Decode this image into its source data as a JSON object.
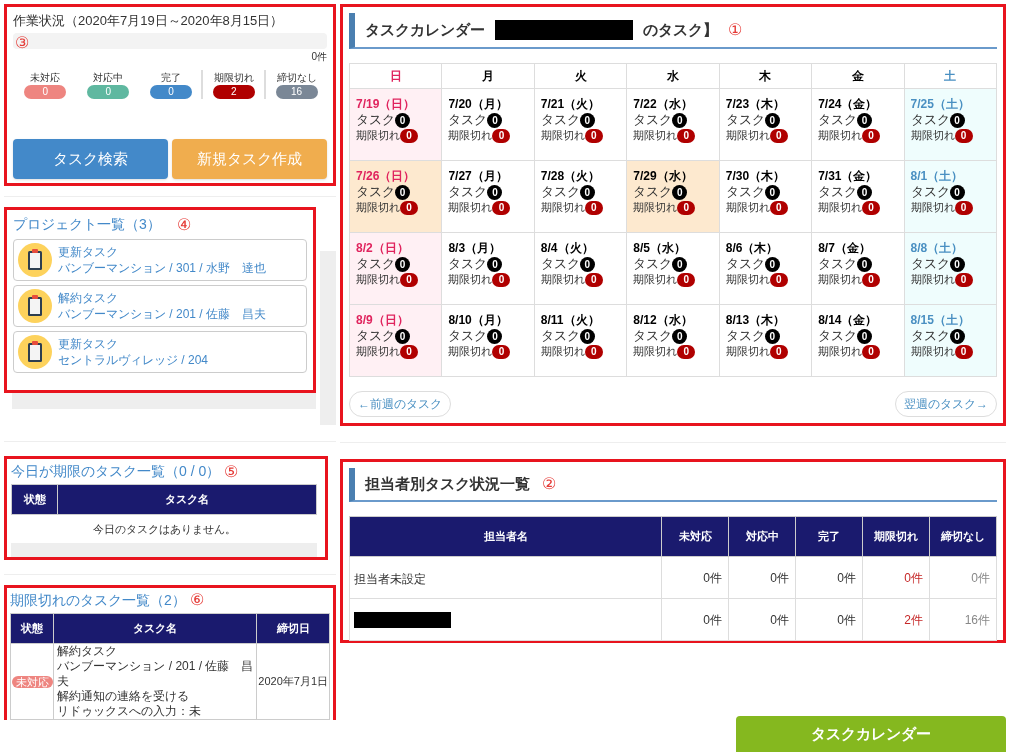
{
  "work_status": {
    "title": "作業状況（2020年7月19日～2020年8月15日）",
    "marker": "③",
    "progress": {
      "level": 0,
      "count": "0件"
    },
    "statuses": [
      {
        "label": "未対応",
        "count": "0",
        "color": "#ee8580",
        "separated": false
      },
      {
        "label": "対応中",
        "count": "0",
        "color": "#5fb8a0",
        "separated": false
      },
      {
        "label": "完了",
        "count": "0",
        "color": "#4389c9",
        "separated": false
      },
      {
        "label": "期限切れ",
        "count": "2",
        "color": "#b00000",
        "separated": true
      },
      {
        "label": "締切なし",
        "count": "16",
        "color": "#7a8796",
        "separated": true
      }
    ],
    "buttons": [
      {
        "label": "タスク検索",
        "kind": "primary"
      },
      {
        "label": "新規タスク作成",
        "kind": "warning"
      }
    ]
  },
  "projects": {
    "title": "プロジェクト一覧（3）",
    "marker": "④",
    "items": [
      {
        "title": "更新タスク",
        "detail": "バンブーマンション / 301 / 水野　達也"
      },
      {
        "title": "解約タスク",
        "detail": "バンブーマンション / 201 / 佐藤　昌夫"
      },
      {
        "title": "更新タスク",
        "detail": "セントラルヴィレッジ / 204"
      }
    ]
  },
  "today_tasks": {
    "title": "今日が期限のタスク一覧（0 / 0）",
    "marker": "⑤",
    "columns": [
      "状態",
      "タスク名"
    ],
    "empty_message": "今日のタスクはありません。"
  },
  "overdue_tasks": {
    "title": "期限切れのタスク一覧（2）",
    "marker": "⑥",
    "columns": [
      "状態",
      "タスク名",
      "締切日"
    ],
    "rows": [
      {
        "status": "未対応",
        "lines": [
          "解約タスク",
          "バンブーマンション / 201 / 佐藤　昌",
          "夫",
          "解約通知の連絡を受ける",
          "リドゥックスへの入力：未"
        ],
        "deadline": "2020年7月1日"
      }
    ]
  },
  "calendar": {
    "title": "タスクカレンダー",
    "suffix": "のタスク】",
    "marker": "①",
    "weekdays": [
      {
        "label": "日",
        "kind": "sun"
      },
      {
        "label": "月",
        "kind": "weekday"
      },
      {
        "label": "火",
        "kind": "weekday"
      },
      {
        "label": "水",
        "kind": "weekday"
      },
      {
        "label": "木",
        "kind": "weekday"
      },
      {
        "label": "金",
        "kind": "weekday"
      },
      {
        "label": "土",
        "kind": "sat"
      }
    ],
    "weeks": [
      [
        {
          "date": "7/19（日）",
          "kind": "sun",
          "highlight": false,
          "task_label": "タスク",
          "tasks": "0",
          "overdue_label": "期限切れ",
          "overdue": "0"
        },
        {
          "date": "7/20（月）",
          "kind": "weekday",
          "highlight": false,
          "task_label": "タスク",
          "tasks": "0",
          "overdue_label": "期限切れ",
          "overdue": "0"
        },
        {
          "date": "7/21（火）",
          "kind": "weekday",
          "highlight": false,
          "task_label": "タスク",
          "tasks": "0",
          "overdue_label": "期限切れ",
          "overdue": "0"
        },
        {
          "date": "7/22（水）",
          "kind": "weekday",
          "highlight": false,
          "task_label": "タスク",
          "tasks": "0",
          "overdue_label": "期限切れ",
          "overdue": "0"
        },
        {
          "date": "7/23（木）",
          "kind": "weekday",
          "highlight": false,
          "task_label": "タスク",
          "tasks": "0",
          "overdue_label": "期限切れ",
          "overdue": "0"
        },
        {
          "date": "7/24（金）",
          "kind": "weekday",
          "highlight": false,
          "task_label": "タスク",
          "tasks": "0",
          "overdue_label": "期限切れ",
          "overdue": "0"
        },
        {
          "date": "7/25（土）",
          "kind": "sat",
          "highlight": false,
          "task_label": "タスク",
          "tasks": "0",
          "overdue_label": "期限切れ",
          "overdue": "0"
        }
      ],
      [
        {
          "date": "7/26（日）",
          "kind": "sun",
          "highlight": true,
          "task_label": "タスク",
          "tasks": "0",
          "overdue_label": "期限切れ",
          "overdue": "0"
        },
        {
          "date": "7/27（月）",
          "kind": "weekday",
          "highlight": false,
          "task_label": "タスク",
          "tasks": "0",
          "overdue_label": "期限切れ",
          "overdue": "0"
        },
        {
          "date": "7/28（火）",
          "kind": "weekday",
          "highlight": false,
          "task_label": "タスク",
          "tasks": "0",
          "overdue_label": "期限切れ",
          "overdue": "0"
        },
        {
          "date": "7/29（水）",
          "kind": "weekday",
          "highlight": true,
          "task_label": "タスク",
          "tasks": "0",
          "overdue_label": "期限切れ",
          "overdue": "0"
        },
        {
          "date": "7/30（木）",
          "kind": "weekday",
          "highlight": false,
          "task_label": "タスク",
          "tasks": "0",
          "overdue_label": "期限切れ",
          "overdue": "0"
        },
        {
          "date": "7/31（金）",
          "kind": "weekday",
          "highlight": false,
          "task_label": "タスク",
          "tasks": "0",
          "overdue_label": "期限切れ",
          "overdue": "0"
        },
        {
          "date": "8/1（土）",
          "kind": "sat",
          "highlight": false,
          "task_label": "タスク",
          "tasks": "0",
          "overdue_label": "期限切れ",
          "overdue": "0"
        }
      ],
      [
        {
          "date": "8/2（日）",
          "kind": "sun",
          "highlight": false,
          "task_label": "タスク",
          "tasks": "0",
          "overdue_label": "期限切れ",
          "overdue": "0"
        },
        {
          "date": "8/3（月）",
          "kind": "weekday",
          "highlight": false,
          "task_label": "タスク",
          "tasks": "0",
          "overdue_label": "期限切れ",
          "overdue": "0"
        },
        {
          "date": "8/4（火）",
          "kind": "weekday",
          "highlight": false,
          "task_label": "タスク",
          "tasks": "0",
          "overdue_label": "期限切れ",
          "overdue": "0"
        },
        {
          "date": "8/5（水）",
          "kind": "weekday",
          "highlight": false,
          "task_label": "タスク",
          "tasks": "0",
          "overdue_label": "期限切れ",
          "overdue": "0"
        },
        {
          "date": "8/6（木）",
          "kind": "weekday",
          "highlight": false,
          "task_label": "タスク",
          "tasks": "0",
          "overdue_label": "期限切れ",
          "overdue": "0"
        },
        {
          "date": "8/7（金）",
          "kind": "weekday",
          "highlight": false,
          "task_label": "タスク",
          "tasks": "0",
          "overdue_label": "期限切れ",
          "overdue": "0"
        },
        {
          "date": "8/8（土）",
          "kind": "sat",
          "highlight": false,
          "task_label": "タスク",
          "tasks": "0",
          "overdue_label": "期限切れ",
          "overdue": "0"
        }
      ],
      [
        {
          "date": "8/9（日）",
          "kind": "sun",
          "highlight": false,
          "task_label": "タスク",
          "tasks": "0",
          "overdue_label": "期限切れ",
          "overdue": "0"
        },
        {
          "date": "8/10（月）",
          "kind": "weekday",
          "highlight": false,
          "task_label": "タスク",
          "tasks": "0",
          "overdue_label": "期限切れ",
          "overdue": "0"
        },
        {
          "date": "8/11（火）",
          "kind": "weekday",
          "highlight": false,
          "task_label": "タスク",
          "tasks": "0",
          "overdue_label": "期限切れ",
          "overdue": "0"
        },
        {
          "date": "8/12（水）",
          "kind": "weekday",
          "highlight": false,
          "task_label": "タスク",
          "tasks": "0",
          "overdue_label": "期限切れ",
          "overdue": "0"
        },
        {
          "date": "8/13（木）",
          "kind": "weekday",
          "highlight": false,
          "task_label": "タスク",
          "tasks": "0",
          "overdue_label": "期限切れ",
          "overdue": "0"
        },
        {
          "date": "8/14（金）",
          "kind": "weekday",
          "highlight": false,
          "task_label": "タスク",
          "tasks": "0",
          "overdue_label": "期限切れ",
          "overdue": "0"
        },
        {
          "date": "8/15（土）",
          "kind": "sat",
          "highlight": false,
          "task_label": "タスク",
          "tasks": "0",
          "overdue_label": "期限切れ",
          "overdue": "0"
        }
      ]
    ],
    "prev_button": "←前週のタスク",
    "next_button": "翌週のタスク→"
  },
  "staff_status": {
    "title": "担当者別タスク状況一覧",
    "marker": "②",
    "columns": [
      "担当者名",
      "未対応",
      "対応中",
      "完了",
      "期限切れ",
      "締切なし"
    ],
    "rows": [
      {
        "name": "担当者未設定",
        "redacted": false,
        "values": [
          "0件",
          "0件",
          "0件",
          "0件",
          "0件"
        ]
      },
      {
        "name": "",
        "redacted": true,
        "values": [
          "0件",
          "0件",
          "0件",
          "2件",
          "16件"
        ]
      }
    ]
  },
  "footer_button": "タスクカレンダー"
}
